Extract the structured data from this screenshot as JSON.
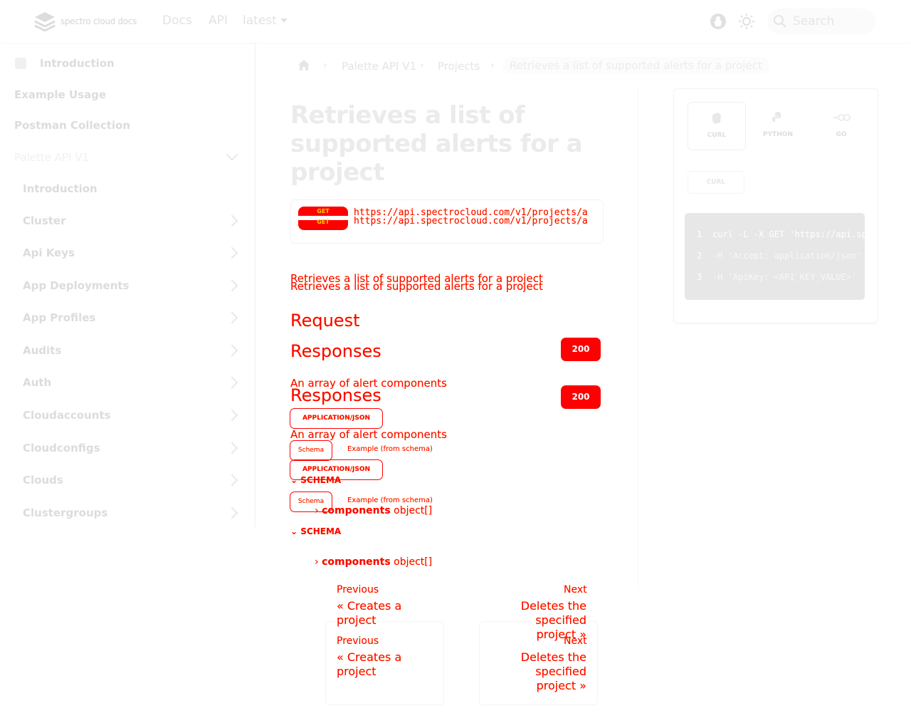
{
  "navbar": {
    "logo_text": "spectro cloud docs",
    "links": [
      "Docs",
      "API",
      "latest"
    ],
    "search_placeholder": "Search"
  },
  "sidebar": {
    "items": [
      {
        "label": "Introduction"
      },
      {
        "label": "Example Usage"
      },
      {
        "label": "Postman Collection"
      },
      {
        "label": "Palette API V1"
      },
      {
        "label": "Introduction"
      },
      {
        "label": "Cluster"
      },
      {
        "label": "Api Keys"
      },
      {
        "label": "App Deployments"
      },
      {
        "label": "App Profiles"
      },
      {
        "label": "Audits"
      },
      {
        "label": "Auth"
      },
      {
        "label": "Cloudaccounts"
      },
      {
        "label": "Cloudconfigs"
      },
      {
        "label": "Clouds"
      },
      {
        "label": "Clustergroups"
      }
    ]
  },
  "breadcrumb": {
    "items": [
      "Palette API V1",
      "Projects"
    ],
    "current": "Retrieves a list of supported alerts for a project"
  },
  "main": {
    "title_lines": [
      "Retrieves a list of",
      "supported alerts for a",
      "project"
    ],
    "method": "GET",
    "url": "https://api.spectrocloud.com/v1/projects/a",
    "description": "Retrieves a list of supported alerts for a project",
    "request_heading": "Request",
    "responses_heading": "Responses",
    "status_code": "200",
    "response_description": "An array of alert components",
    "content_type": "APPLICATION/JSON",
    "schema_tab": "Schema",
    "example_tab": "Example (from schema)",
    "schema_label": "SCHEMA",
    "property_name": "components",
    "property_type": "object[]"
  },
  "pagination": {
    "previous_label": "Previous",
    "previous_title": [
      "« Creates a",
      "project"
    ],
    "next_label": "Next",
    "next_title": [
      "Deletes the",
      "specified",
      "project »"
    ]
  },
  "code_panel": {
    "tabs": [
      "CURL",
      "PYTHON",
      "GO"
    ],
    "selected_chip": "CURL",
    "lines": [
      {
        "num": "1",
        "text": "curl -L -X GET 'https://api.sp"
      },
      {
        "num": "2",
        "text": "-H 'Accept: application/json'"
      },
      {
        "num": "3",
        "text": "-H 'ApiKey: <API_KEY_VALUE>'"
      }
    ]
  }
}
